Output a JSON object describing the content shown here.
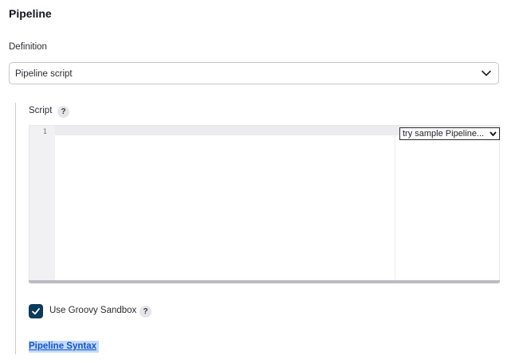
{
  "section": {
    "title": "Pipeline"
  },
  "definition": {
    "label": "Definition",
    "selected": "Pipeline script"
  },
  "script": {
    "label": "Script",
    "help": "?",
    "line_numbers": [
      "1"
    ],
    "sample_select": "try sample Pipeline..."
  },
  "sandbox": {
    "label": "Use Groovy Sandbox",
    "checked": true,
    "help": "?"
  },
  "links": {
    "pipeline_syntax": "Pipeline Syntax"
  }
}
